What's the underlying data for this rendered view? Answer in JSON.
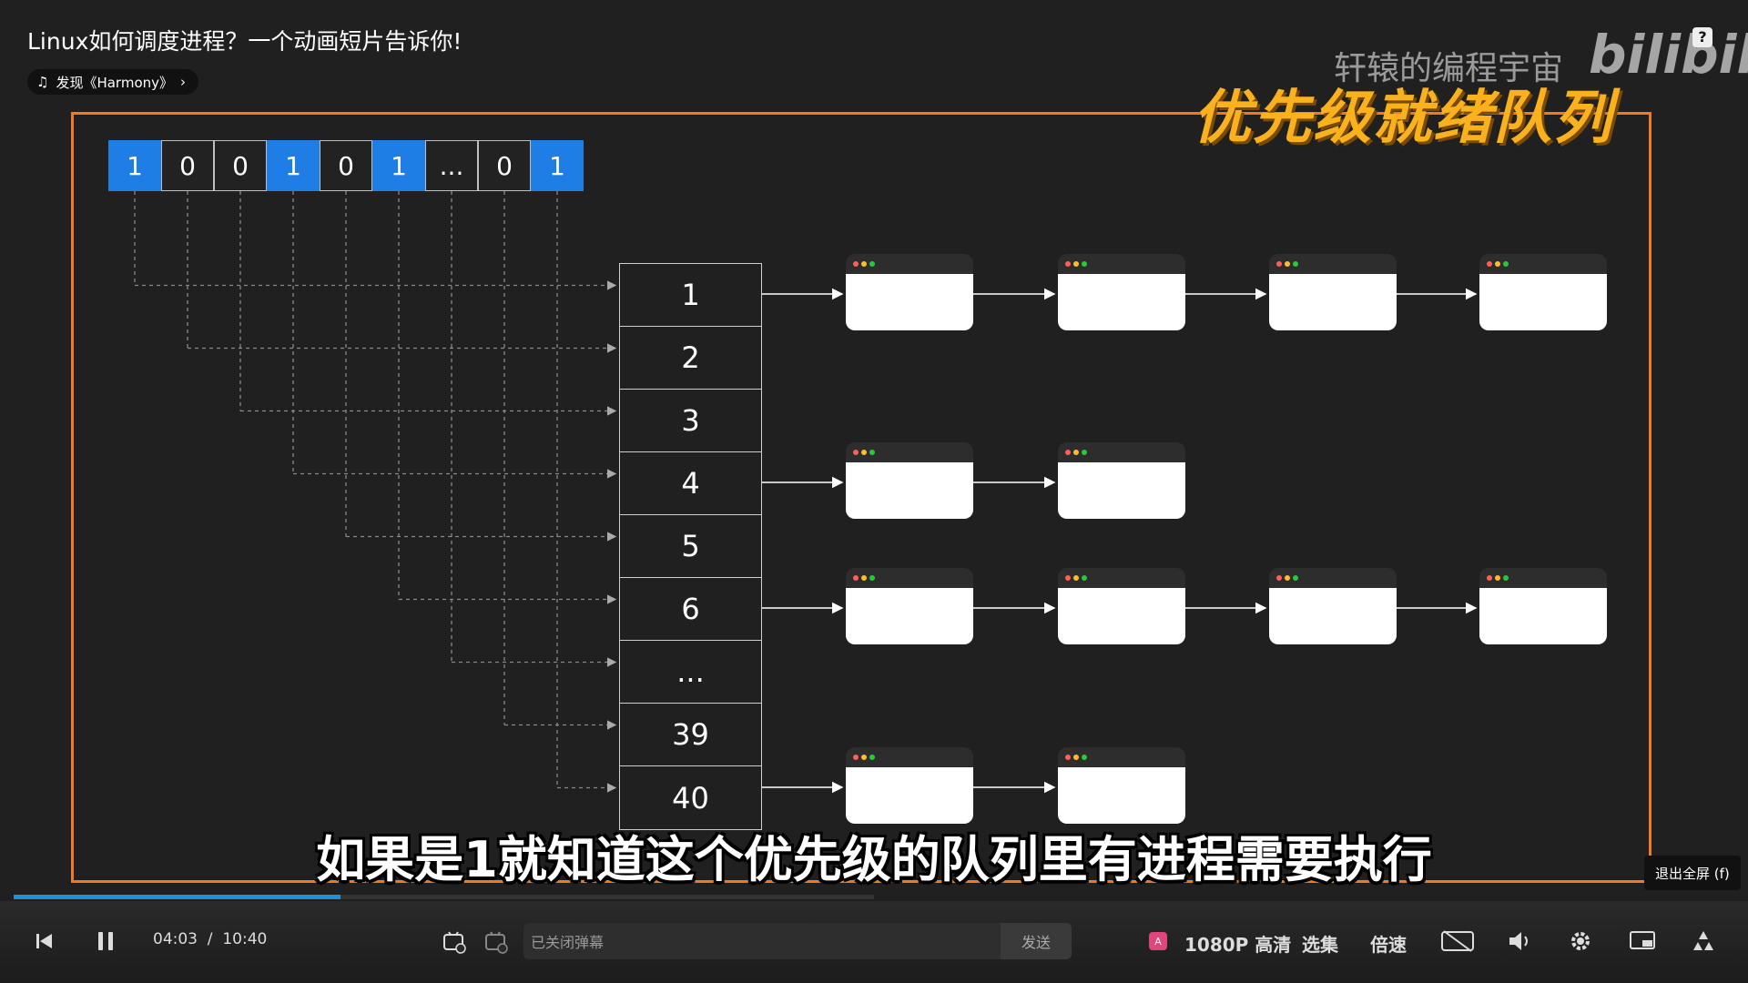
{
  "video": {
    "title": "Linux如何调度进程？一个动画短片告诉你!",
    "music": "发现《Harmony》",
    "watermark": "轩辕的编程宇宙",
    "logo": "bilibili",
    "help": "?"
  },
  "slide": {
    "heading": "优先级就绪队列",
    "bitmap": [
      {
        "label": "1",
        "set": true
      },
      {
        "label": "0",
        "set": false
      },
      {
        "label": "0",
        "set": false
      },
      {
        "label": "1",
        "set": true
      },
      {
        "label": "0",
        "set": false
      },
      {
        "label": "1",
        "set": true
      },
      {
        "label": "...",
        "set": false
      },
      {
        "label": "0",
        "set": false
      },
      {
        "label": "1",
        "set": true
      }
    ],
    "queue": [
      "1",
      "2",
      "3",
      "4",
      "5",
      "6",
      "...",
      "39",
      "40"
    ],
    "process_counts": {
      "1": 4,
      "4": 2,
      "6": 4,
      "40": 2
    },
    "dot_colors": [
      "#ff5f56",
      "#ffbd2e",
      "#27c93f"
    ],
    "subtitle": "如果是1就知道这个优先级的队列里有进程需要执行"
  },
  "player": {
    "exit_fullscreen": "退出全屏 (f)",
    "time_current": "04:03",
    "time_total": "10:40",
    "progress": 0.38,
    "danmaku_placeholder": "已关闭弹幕",
    "send": "发送",
    "quality": "1080P 高清",
    "episodes": "选集",
    "speed": "倍速"
  }
}
